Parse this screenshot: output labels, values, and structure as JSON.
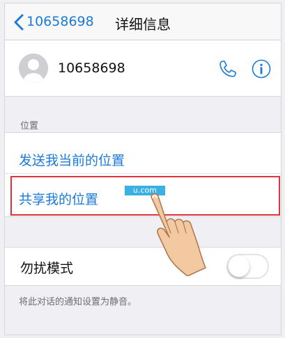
{
  "navbar": {
    "back_label": "10658698",
    "title": "详细信息",
    "accent_color": "#1a7ad9"
  },
  "contact": {
    "name": "10658698",
    "avatar_icon": "person-silhouette-icon",
    "phone_icon": "phone-icon",
    "info_icon": "info-icon"
  },
  "location_section": {
    "header": "位置",
    "items": [
      {
        "label": "发送我当前的位置"
      },
      {
        "label": "共享我的位置"
      }
    ],
    "highlight_color": "#e0323a"
  },
  "watermark": {
    "text": "u.com"
  },
  "do_not_disturb": {
    "label": "勿扰模式",
    "toggle_on": false,
    "footnote": "将此对话的通知设置为静音。"
  },
  "annotation": {
    "pointer_icon": "pointing-hand-icon"
  }
}
